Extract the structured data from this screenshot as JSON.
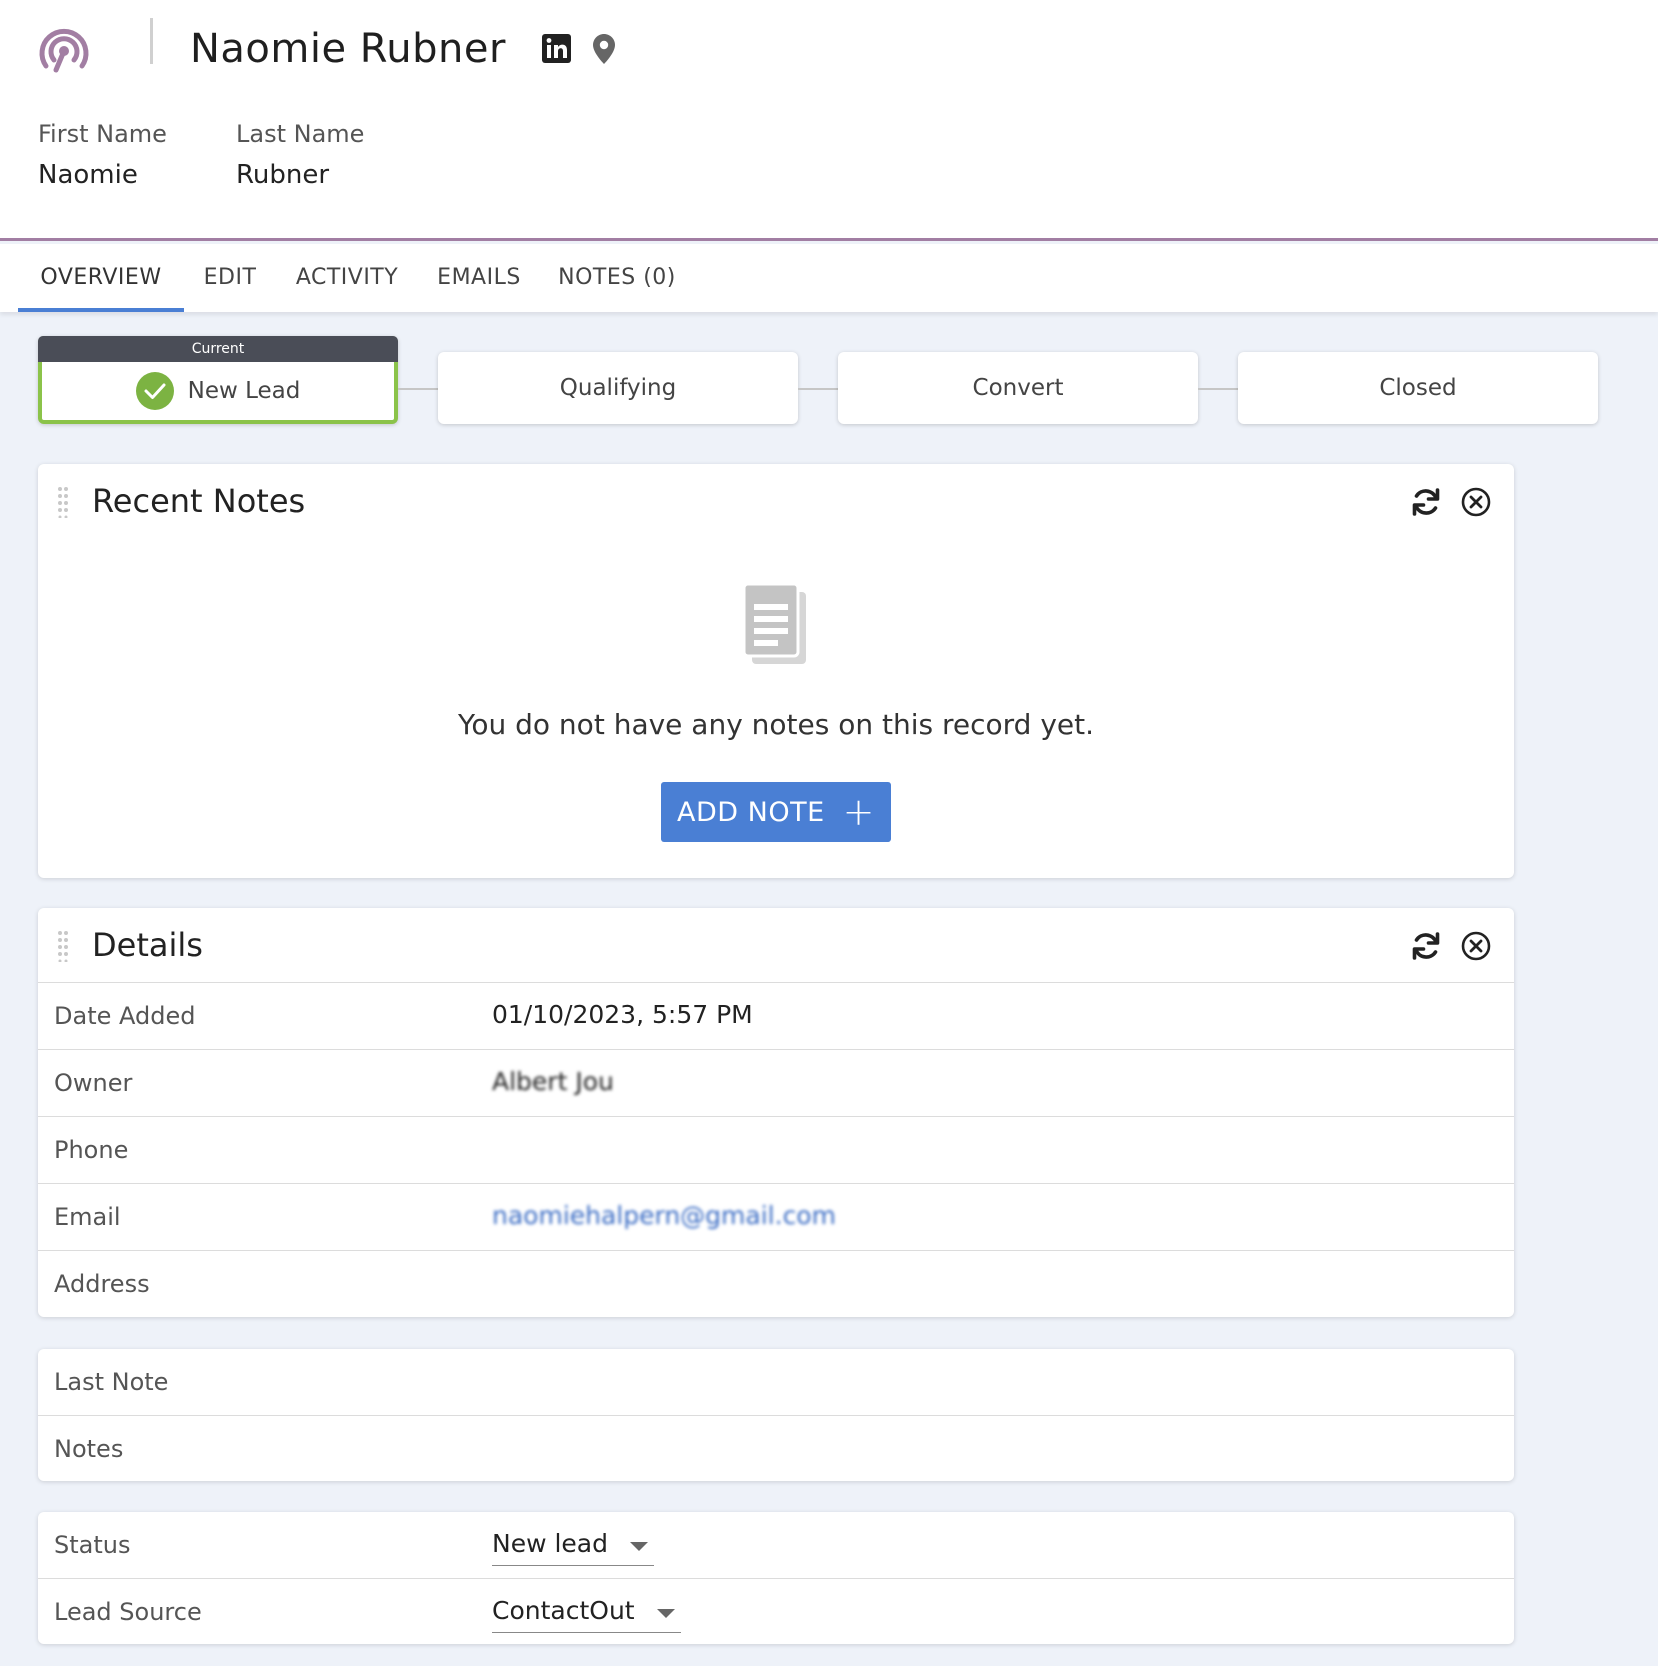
{
  "header": {
    "title": "Naomie Rubner",
    "first_name_label": "First Name",
    "first_name": "Naomie",
    "last_name_label": "Last Name",
    "last_name": "Rubner"
  },
  "tabs": [
    {
      "label": "OVERVIEW",
      "active": true
    },
    {
      "label": "EDIT"
    },
    {
      "label": "ACTIVITY"
    },
    {
      "label": "EMAILS"
    },
    {
      "label": "NOTES (0)"
    }
  ],
  "stages": {
    "current_badge": "Current",
    "items": [
      "New Lead",
      "Qualifying",
      "Convert",
      "Closed"
    ],
    "current_index": 0
  },
  "recent_notes": {
    "title": "Recent Notes",
    "empty_text": "You do not have any notes on this record yet.",
    "add_button": "ADD NOTE"
  },
  "details": {
    "title": "Details",
    "rows": [
      {
        "label": "Date Added",
        "value": "01/10/2023, 5:57 PM"
      },
      {
        "label": "Owner",
        "value": "Albert Jou"
      },
      {
        "label": "Phone",
        "value": ""
      },
      {
        "label": "Email",
        "value": "naomiehalpern@gmail.com"
      },
      {
        "label": "Address",
        "value": ""
      }
    ]
  },
  "notes_card": {
    "rows": [
      {
        "label": "Last Note"
      },
      {
        "label": "Notes"
      }
    ]
  },
  "status_card": {
    "status_label": "Status",
    "status_value": "New lead",
    "lead_source_label": "Lead Source",
    "lead_source_value": "ContactOut"
  },
  "colors": {
    "accent": "#4a7fd4",
    "brand": "#a27ea3",
    "current_stage": "#8bc34a",
    "background": "#eef2f9"
  },
  "icons": {
    "logo": "signal-logo-icon",
    "linkedin": "linkedin-icon",
    "location": "map-pin-icon",
    "refresh": "refresh-icon",
    "close": "close-circle-icon",
    "drag": "drag-handle-icon",
    "empty_notes": "document-icon",
    "check": "check-circle-icon"
  }
}
